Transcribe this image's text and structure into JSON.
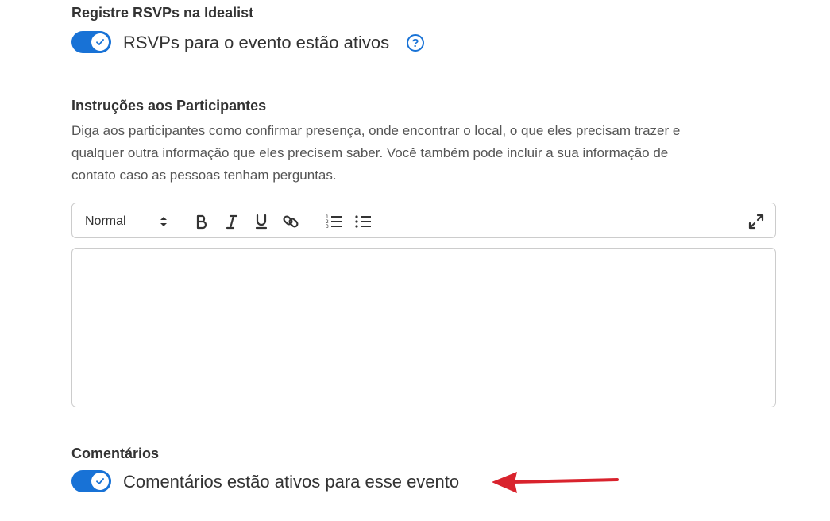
{
  "rsvp_section": {
    "title": "Registre RSVPs na Idealist",
    "toggle_label": "RSVPs para o evento estão ativos",
    "toggle_on": true,
    "help_symbol": "?"
  },
  "instructions_section": {
    "title": "Instruções aos Participantes",
    "description_lines": [
      "Diga aos participantes como confirmar presença, onde encontrar o local, o que eles precisam trazer e",
      "qualquer outra informação que eles precisem saber. Você também pode incluir a sua informação de",
      "contato caso as pessoas tenham perguntas."
    ]
  },
  "editor": {
    "format_value": "Normal",
    "toolbar_icons": [
      "updown-arrows-icon",
      "bold-icon",
      "italic-icon",
      "underline-icon",
      "link-icon",
      "ordered-list-icon",
      "bullet-list-icon",
      "expand-icon"
    ],
    "content": ""
  },
  "comments_section": {
    "title": "Comentários",
    "toggle_label": "Comentários estão ativos para esse evento",
    "toggle_on": true
  },
  "colors": {
    "accent": "#1872d6",
    "annotation_arrow": "#d9232d",
    "border": "#cccccc",
    "text": "#333333",
    "muted_text": "#555555"
  }
}
